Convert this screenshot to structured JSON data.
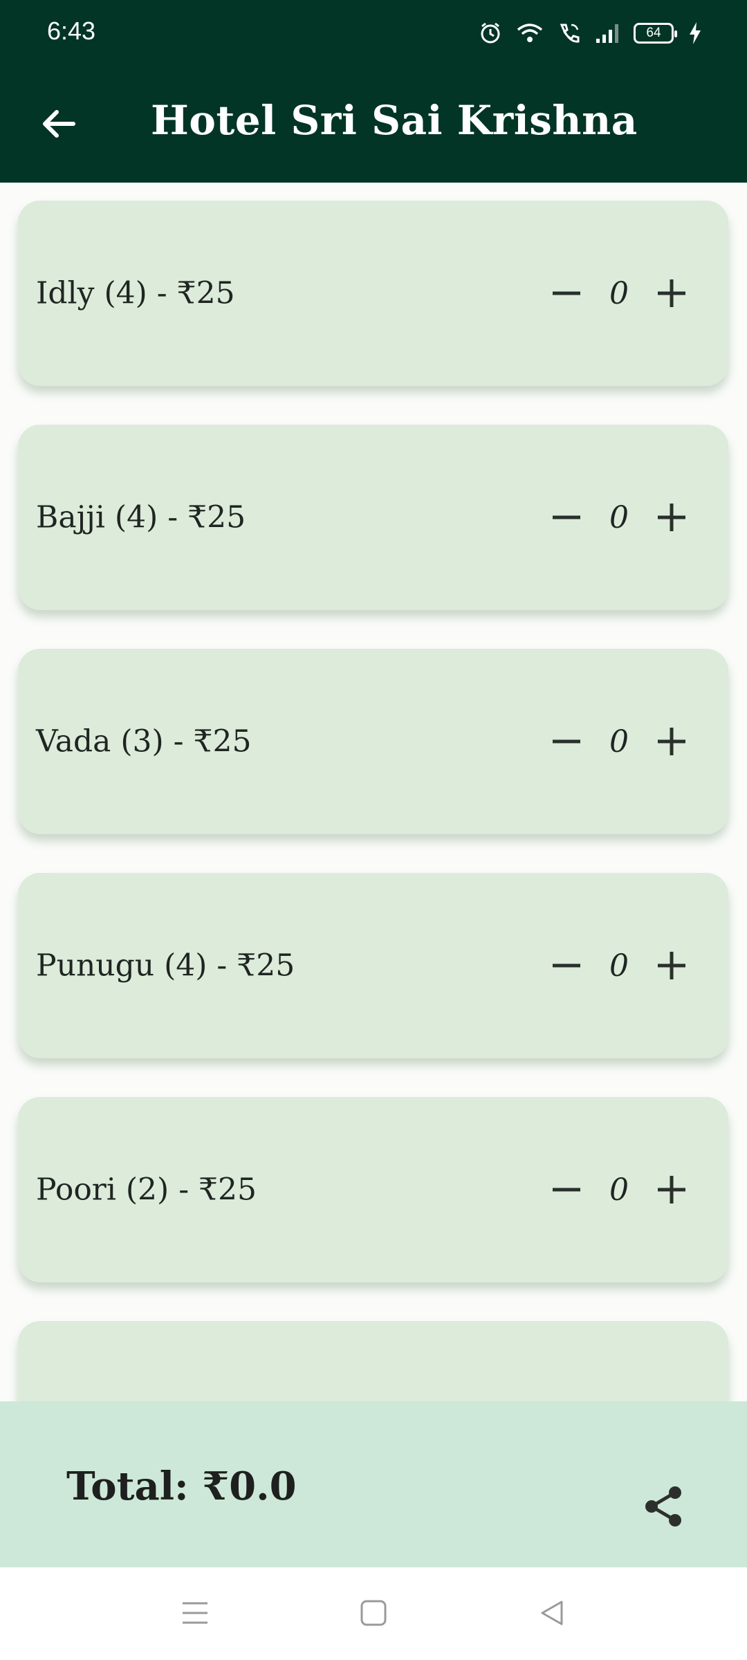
{
  "status_bar": {
    "time": "6:43",
    "battery": "64",
    "icons": [
      "alarm-icon",
      "wifi-icon",
      "wifi-calling-icon",
      "signal-icon",
      "battery-icon",
      "charging-icon"
    ]
  },
  "app_bar": {
    "title": "Hotel Sri Sai Krishna",
    "back_icon": "arrow-left-icon",
    "color": "#023526"
  },
  "menu_items": [
    {
      "label": "Idly (4) - ₹25",
      "qty": "0"
    },
    {
      "label": "Bajji (4) - ₹25",
      "qty": "0"
    },
    {
      "label": "Vada (3) - ₹25",
      "qty": "0"
    },
    {
      "label": "Punugu (4) - ₹25",
      "qty": "0"
    },
    {
      "label": "Poori (2) - ₹25",
      "qty": "0"
    }
  ],
  "footer": {
    "total": "Total: ₹0.0",
    "share_icon": "share-icon"
  },
  "colors": {
    "card": "#dcebda",
    "footer": "#cde8d8"
  }
}
